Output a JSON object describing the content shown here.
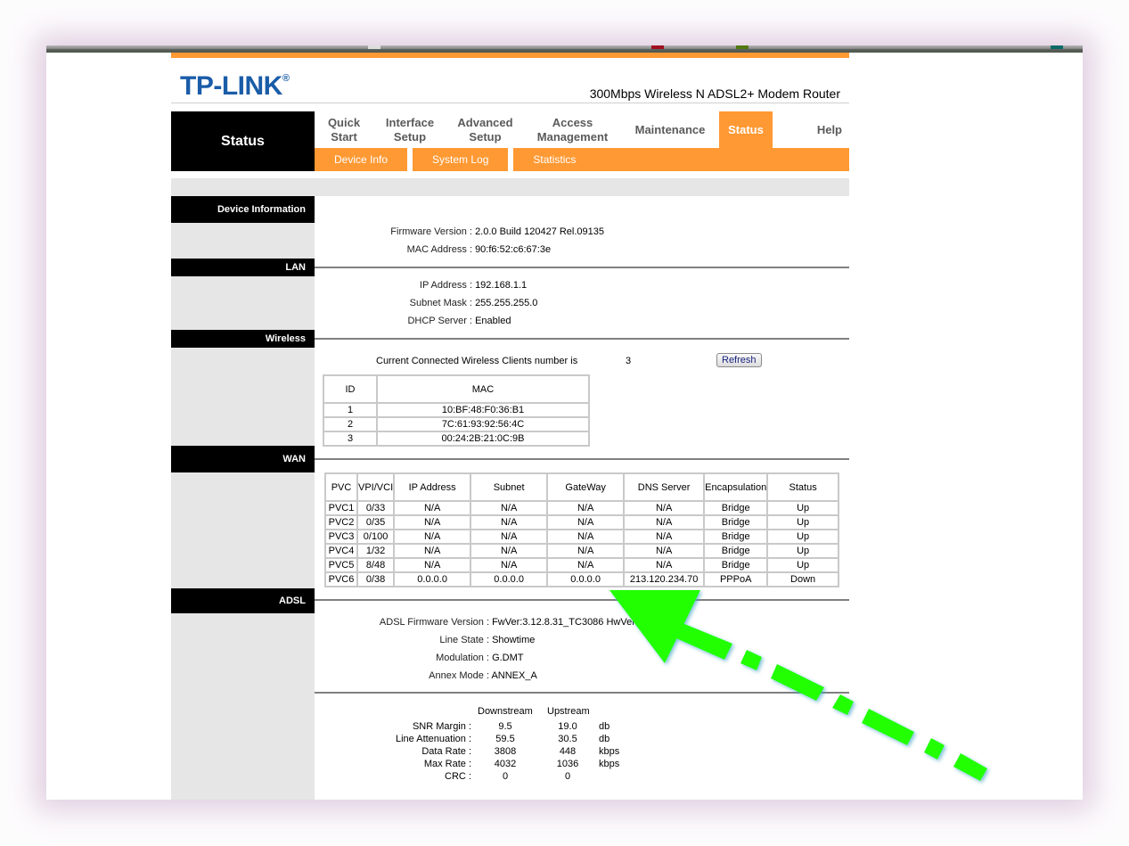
{
  "header": {
    "logo": "TP-LINK",
    "logo_mark": "®",
    "model": "300Mbps Wireless N ADSL2+ Modem Router"
  },
  "nav": {
    "title": "Status",
    "items": [
      {
        "label": "Quick\nStart"
      },
      {
        "label": "Interface\nSetup"
      },
      {
        "label": "Advanced\nSetup"
      },
      {
        "label": "Access\nManagement"
      },
      {
        "label": "Maintenance"
      },
      {
        "label": "Status",
        "active": true
      },
      {
        "label": "Help"
      }
    ],
    "subitems": [
      "Device Info",
      "System Log",
      "Statistics"
    ]
  },
  "colors": {
    "accent": "#ff9933",
    "brand": "#1a5ca8",
    "annotation_arrow": "#22ff00"
  },
  "device_info": {
    "heading": "Device Information",
    "firmware_label": "Firmware Version :",
    "firmware_value": "2.0.0 Build 120427 Rel.09135",
    "mac_label": "MAC Address :",
    "mac_value": "90:f6:52:c6:67:3e"
  },
  "lan": {
    "heading": "LAN",
    "ip_label": "IP Address :",
    "ip_value": "192.168.1.1",
    "mask_label": "Subnet Mask :",
    "mask_value": "255.255.255.0",
    "dhcp_label": "DHCP Server :",
    "dhcp_value": "Enabled"
  },
  "wireless": {
    "heading": "Wireless",
    "clients_label": "Current Connected Wireless Clients number is",
    "clients_count": "3",
    "refresh_label": "Refresh",
    "columns": [
      "ID",
      "MAC"
    ],
    "rows": [
      [
        "1",
        "10:BF:48:F0:36:B1"
      ],
      [
        "2",
        "7C:61:93:92:56:4C"
      ],
      [
        "3",
        "00:24:2B:21:0C:9B"
      ]
    ]
  },
  "wan": {
    "heading": "WAN",
    "columns": [
      "PVC",
      "VPI/VCI",
      "IP Address",
      "Subnet",
      "GateWay",
      "DNS Server",
      "Encapsulation",
      "Status"
    ],
    "rows": [
      [
        "PVC1",
        "0/33",
        "N/A",
        "N/A",
        "N/A",
        "N/A",
        "Bridge",
        "Up"
      ],
      [
        "PVC2",
        "0/35",
        "N/A",
        "N/A",
        "N/A",
        "N/A",
        "Bridge",
        "Up"
      ],
      [
        "PVC3",
        "0/100",
        "N/A",
        "N/A",
        "N/A",
        "N/A",
        "Bridge",
        "Up"
      ],
      [
        "PVC4",
        "1/32",
        "N/A",
        "N/A",
        "N/A",
        "N/A",
        "Bridge",
        "Up"
      ],
      [
        "PVC5",
        "8/48",
        "N/A",
        "N/A",
        "N/A",
        "N/A",
        "Bridge",
        "Up"
      ],
      [
        "PVC6",
        "0/38",
        "0.0.0.0",
        "0.0.0.0",
        "0.0.0.0",
        "213.120.234.70",
        "PPPoA",
        "Down"
      ]
    ]
  },
  "adsl": {
    "heading": "ADSL",
    "fw_label": "ADSL Firmware Version :",
    "fw_value": "FwVer:3.12.8.31_TC3086 HwVer:T1",
    "line_label": "Line State :",
    "line_value": "Showtime",
    "mod_label": "Modulation :",
    "mod_value": "G.DMT",
    "annex_label": "Annex Mode :",
    "annex_value": "ANNEX_A",
    "stats": {
      "col_down": "Downstream",
      "col_up": "Upstream",
      "rows": [
        {
          "label": "SNR Margin :",
          "down": "9.5",
          "up": "19.0",
          "unit": "db"
        },
        {
          "label": "Line Attenuation :",
          "down": "59.5",
          "up": "30.5",
          "unit": "db"
        },
        {
          "label": "Data Rate :",
          "down": "3808",
          "up": "448",
          "unit": "kbps"
        },
        {
          "label": "Max Rate :",
          "down": "4032",
          "up": "1036",
          "unit": "kbps"
        },
        {
          "label": "CRC :",
          "down": "0",
          "up": "0",
          "unit": ""
        }
      ]
    }
  }
}
